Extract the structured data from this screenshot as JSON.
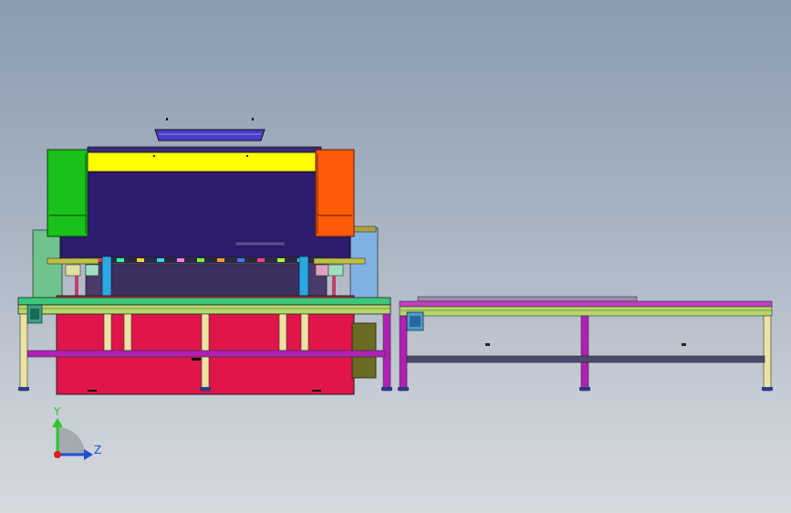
{
  "viewport": {
    "background_top": "#8a9cb0",
    "background_bottom": "#d6dadf"
  },
  "model": {
    "colors": {
      "top_beam_yellow": "#ffff00",
      "ram_body_navy": "#2e1a6e",
      "left_cover_green": "#19c219",
      "right_cover_orange": "#ff5a0a",
      "cabinet_red": "#e0154a",
      "table_green": "#3cc87a",
      "frame_yellowgreen": "#b6d86a",
      "leg_cream": "#ece2a2",
      "crossbar_magenta": "#b020b4",
      "cyan_posts": "#2aa8e0",
      "side_panel_lightblue": "#7fb2e0",
      "side_panel_green": "#6ec48c"
    }
  },
  "triad": {
    "y_label": "Y",
    "z_label": "Z",
    "y_color": "#2bc62b",
    "z_color": "#1f4fd6",
    "origin_color": "#e02020"
  }
}
